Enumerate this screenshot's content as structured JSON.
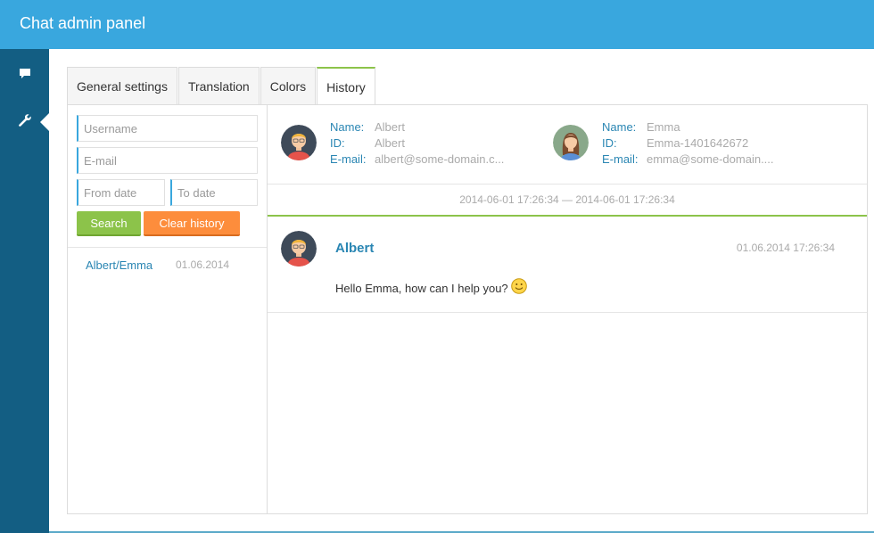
{
  "app": {
    "title": "Chat admin panel"
  },
  "sidebar": {
    "items": [
      {
        "icon": "chat-icon"
      },
      {
        "icon": "wrench-icon"
      }
    ]
  },
  "tabs": [
    {
      "label": "General settings",
      "active": false
    },
    {
      "label": "Translation",
      "active": false
    },
    {
      "label": "Colors",
      "active": false
    },
    {
      "label": "History",
      "active": true
    }
  ],
  "filters": {
    "username_placeholder": "Username",
    "email_placeholder": "E-mail",
    "from_date_placeholder": "From date",
    "to_date_placeholder": "To date",
    "search_label": "Search",
    "clear_label": "Clear history"
  },
  "history_list": [
    {
      "name": "Albert/Emma",
      "date": "01.06.2014"
    }
  ],
  "participants": {
    "labels": {
      "name": "Name:",
      "id": "ID:",
      "email": "E-mail:"
    },
    "albert": {
      "name": "Albert",
      "id": "Albert",
      "email": "albert@some-domain.c..."
    },
    "emma": {
      "name": "Emma",
      "id": "Emma-1401642672",
      "email": "emma@some-domain...."
    }
  },
  "range": "2014-06-01 17:26:34 — 2014-06-01 17:26:34",
  "messages": [
    {
      "author": "Albert",
      "time": "01.06.2014 17:26:34",
      "text": "Hello Emma, how can I help you?",
      "emoji": "smiley-icon"
    }
  ],
  "colors": {
    "topbar": "#39a7de",
    "sidebar": "#135e83",
    "link": "#2a86b3",
    "search": "#8cc34a",
    "clear": "#fd8d3c"
  }
}
